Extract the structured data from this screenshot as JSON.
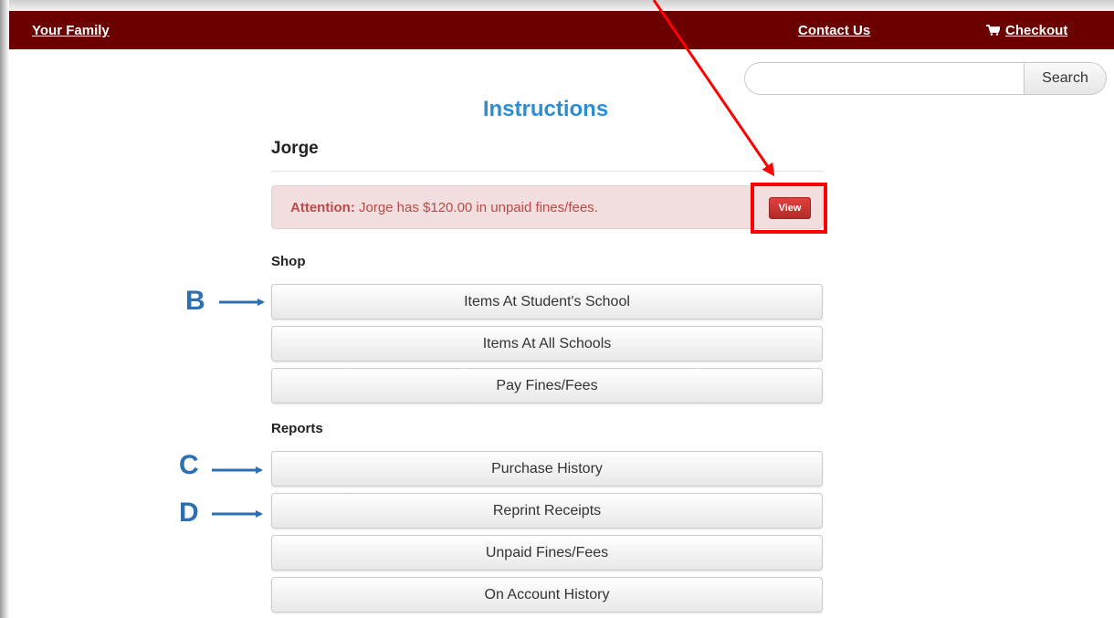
{
  "nav": {
    "family_label": "Your Family",
    "contact_label": "Contact Us",
    "checkout_label": "Checkout",
    "checkout_icon": "cart-icon",
    "bar_color": "#6b0000"
  },
  "search": {
    "value": "",
    "placeholder": "",
    "button_label": "Search"
  },
  "page": {
    "title": "Instructions",
    "title_color": "#2b8ed2",
    "student_name": "Jorge"
  },
  "alert": {
    "label": "Attention:",
    "message": "Jorge has $120.00 in unpaid fines/fees.",
    "view_button_label": "View",
    "highlight_color": "#ff0000"
  },
  "shop": {
    "heading": "Shop",
    "buttons": [
      "Items At Student's School",
      "Items At All Schools",
      "Pay Fines/Fees"
    ]
  },
  "reports": {
    "heading": "Reports",
    "buttons": [
      "Purchase History",
      "Reprint Receipts",
      "Unpaid Fines/Fees",
      "On Account History"
    ]
  },
  "annotations": {
    "letters": [
      "B",
      "C",
      "D"
    ],
    "color": "#2e6faf"
  }
}
